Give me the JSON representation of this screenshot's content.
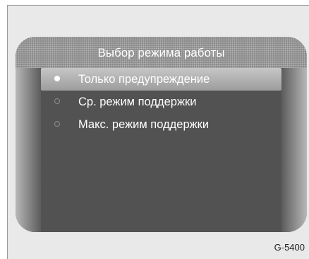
{
  "screen": {
    "title": "Выбор режима работы",
    "options": [
      {
        "label": "Только предупреждение",
        "selected": true
      },
      {
        "label": "Ср. режим поддержки",
        "selected": false
      },
      {
        "label": "Макс. режим поддержки",
        "selected": false
      }
    ]
  },
  "figure_code": "G-5400",
  "colors": {
    "screen_background": "#525252",
    "selection_highlight": "#b0b0b0",
    "text": "#ffffff"
  }
}
